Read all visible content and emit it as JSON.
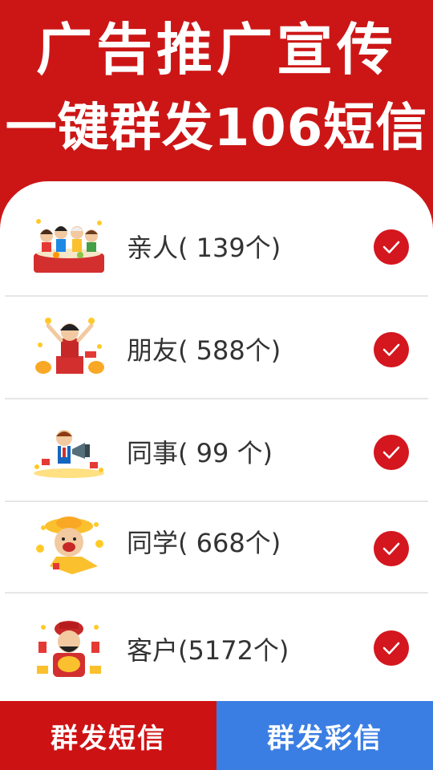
{
  "header": {
    "line1": "广告推广宣传",
    "line2": "一键群发106短信"
  },
  "contacts": [
    {
      "label": "亲人( 139个)",
      "icon": "family-dinner-icon",
      "checked": true
    },
    {
      "label": "朋友( 588个)",
      "icon": "friend-celebration-icon",
      "checked": true
    },
    {
      "label": "同事(  99 个)",
      "icon": "coworker-megaphone-icon",
      "checked": true
    },
    {
      "label": "同学( 668个)",
      "icon": "classmate-cartoon-icon",
      "checked": true
    },
    {
      "label": "客户(5172个)",
      "icon": "fortune-god-icon",
      "checked": true
    }
  ],
  "footer": {
    "sms_label": "群发短信",
    "mms_label": "群发彩信"
  },
  "colors": {
    "brand_red": "#cc1616",
    "check_red": "#d4161e",
    "mms_blue": "#3b7ee3"
  }
}
